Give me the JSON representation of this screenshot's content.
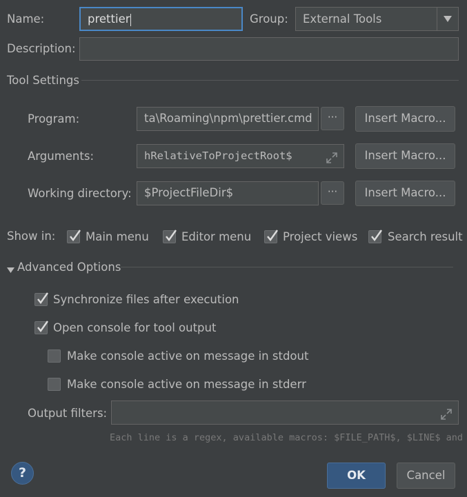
{
  "header": {
    "name_label": "Name:",
    "name_value": "prettier",
    "group_label": "Group:",
    "group_value": "External Tools",
    "description_label": "Description:",
    "description_value": ""
  },
  "tool_settings": {
    "title": "Tool Settings",
    "program_label": "Program:",
    "program_value": "ta\\Roaming\\npm\\prettier.cmd",
    "arguments_label": "Arguments:",
    "arguments_value": "hRelativeToProjectRoot$",
    "working_dir_label": "Working directory:",
    "working_dir_value": "$ProjectFileDir$",
    "browse_label": "···",
    "insert_macro_label": "Insert Macro..."
  },
  "show_in": {
    "label": "Show in:",
    "options": [
      {
        "label": "Main menu",
        "checked": true
      },
      {
        "label": "Editor menu",
        "checked": true
      },
      {
        "label": "Project views",
        "checked": true
      },
      {
        "label": "Search result",
        "checked": true
      }
    ]
  },
  "advanced": {
    "title": "Advanced Options",
    "sync_files": {
      "label": "Synchronize files after execution",
      "checked": true
    },
    "open_console": {
      "label": "Open console for tool output",
      "checked": true
    },
    "active_stdout": {
      "label": "Make console active on message in stdout",
      "checked": false
    },
    "active_stderr": {
      "label": "Make console active on message in stderr",
      "checked": false
    },
    "output_filters_label": "Output filters:",
    "output_filters_value": "",
    "hint": "Each line is a regex, available macros: $FILE_PATH$, $LINE$ and ..."
  },
  "footer": {
    "help_label": "?",
    "ok_label": "OK",
    "cancel_label": "Cancel"
  },
  "colors": {
    "background": "#3c3f41",
    "field_bg": "#45494a",
    "button_bg": "#4c5052",
    "focus_border": "#4a88c7",
    "ok_bg": "#365880",
    "help_bg": "#365880"
  }
}
